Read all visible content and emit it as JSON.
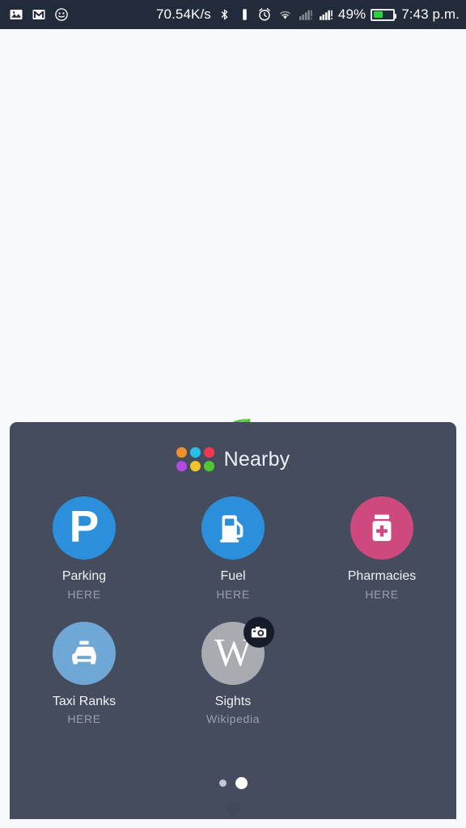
{
  "statusbar": {
    "left_icons": [
      "image-icon",
      "gmail-icon",
      "emoji-face-icon"
    ],
    "network_speed": "70.54K/s",
    "icons": [
      "bluetooth-icon",
      "vibrate-icon",
      "alarm-icon",
      "wifi-icon",
      "signal-sim1-icon",
      "signal-sim2-icon"
    ],
    "battery_percent": "49%",
    "battery_level": 49,
    "battery_color": "#2ad43a",
    "time": "7:43 p.m.",
    "background_color": "#222b3a"
  },
  "panel": {
    "title": "Nearby",
    "background_color": "#454c5e",
    "app_icon_name": "six-dots-grid-icon",
    "dot_colors": [
      "#f0922b",
      "#27c0e8",
      "#f0384f",
      "#b14ae0",
      "#f2c42b",
      "#4fc733"
    ],
    "leaf_icon_name": "green-leaf-icon",
    "leaf_color": "#5bbf2e",
    "items": [
      {
        "label": "Parking",
        "provider": "HERE",
        "icon": "parking-p-icon",
        "color": "#2b8fdb",
        "glyph": "P"
      },
      {
        "label": "Fuel",
        "provider": "HERE",
        "icon": "fuel-pump-icon",
        "color": "#2b8fdb",
        "glyph": ""
      },
      {
        "label": "Pharmacies",
        "provider": "HERE",
        "icon": "pharmacy-bottle-icon",
        "color": "#ce4a7e",
        "glyph": ""
      },
      {
        "label": "Taxi Ranks",
        "provider": "HERE",
        "icon": "taxi-car-icon",
        "color": "#6fa8d6",
        "glyph": ""
      },
      {
        "label": "Sights",
        "provider": "Wikipedia",
        "icon": "wikipedia-w-icon",
        "color": "#a8abb0",
        "glyph": "W",
        "badge": "camera-badge-icon"
      }
    ],
    "pagination": {
      "pages": 2,
      "current": 2
    }
  },
  "map": {
    "background_color": "#f7fafc"
  }
}
